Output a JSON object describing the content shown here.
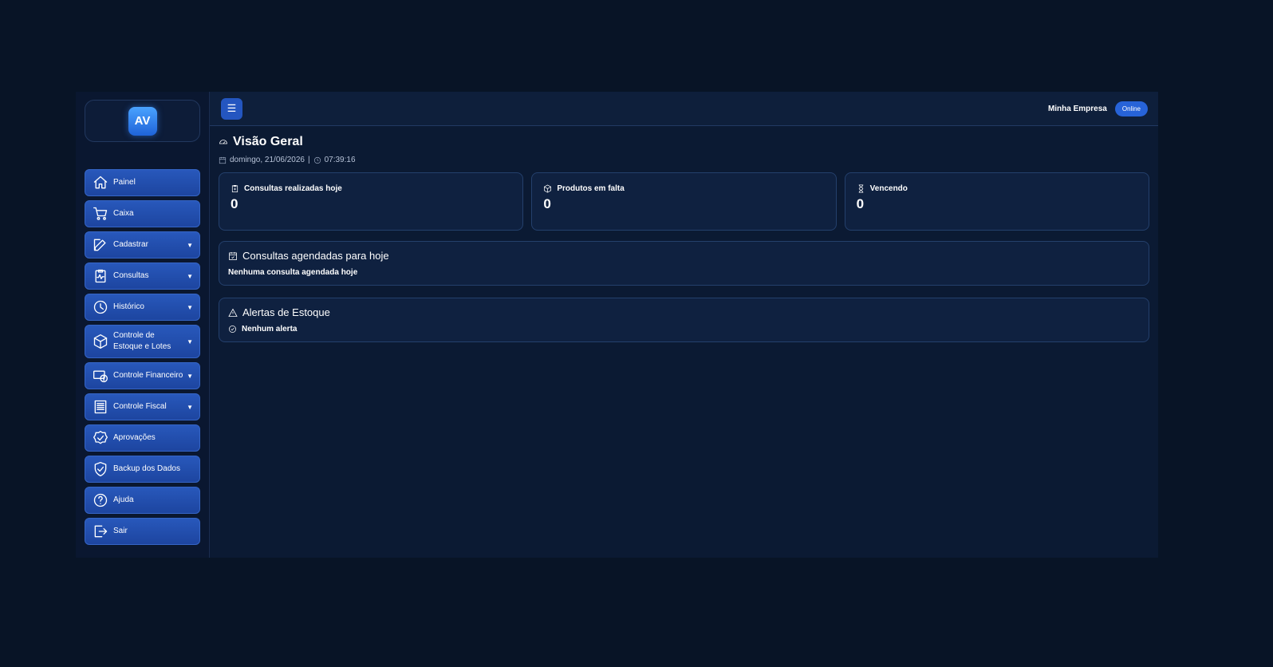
{
  "brand": {
    "logo_text": "AV"
  },
  "sidebar": {
    "items": [
      {
        "label": "Painel",
        "icon": "home-icon",
        "has_caret": false
      },
      {
        "label": "Caixa",
        "icon": "cart-icon",
        "has_caret": false
      },
      {
        "label": "Cadastrar",
        "icon": "edit-icon",
        "has_caret": true
      },
      {
        "label": "Consultas",
        "icon": "clipboard-pulse-icon",
        "has_caret": true
      },
      {
        "label": "Histórico",
        "icon": "clock-icon",
        "has_caret": true
      },
      {
        "label": "Controle de Estoque e Lotes",
        "icon": "box-icon",
        "has_caret": true
      },
      {
        "label": "Controle Financeiro",
        "icon": "money-icon",
        "has_caret": true
      },
      {
        "label": "Controle Fiscal",
        "icon": "receipt-icon",
        "has_caret": true
      },
      {
        "label": "Aprovações",
        "icon": "badge-check-icon",
        "has_caret": false
      },
      {
        "label": "Backup dos Dados",
        "icon": "shield-check-icon",
        "has_caret": false
      },
      {
        "label": "Ajuda",
        "icon": "question-icon",
        "has_caret": false
      },
      {
        "label": "Sair",
        "icon": "logout-icon",
        "has_caret": false
      }
    ],
    "caret": "▼"
  },
  "topbar": {
    "menu_icon": "☰",
    "company": "Minha Empresa",
    "status": "Online"
  },
  "page": {
    "title": "Visão Geral",
    "date": "domingo, 21/06/2026",
    "separator": "|",
    "time": "07:39:16"
  },
  "cards": [
    {
      "label": "Consultas realizadas hoje",
      "value": "0",
      "icon": "clipboard-icon"
    },
    {
      "label": "Produtos em falta",
      "value": "0",
      "icon": "box-icon"
    },
    {
      "label": "Vencendo",
      "value": "0",
      "icon": "hourglass-icon"
    }
  ],
  "appointments": {
    "title": "Consultas agendadas para hoje",
    "empty_text": "Nenhuma consulta agendada hoje"
  },
  "alerts": {
    "title": "Alertas de Estoque",
    "empty_text": "Nenhum alerta"
  },
  "colors": {
    "background": "#081426",
    "accent": "#2456c0",
    "panel": "#0f2140"
  }
}
